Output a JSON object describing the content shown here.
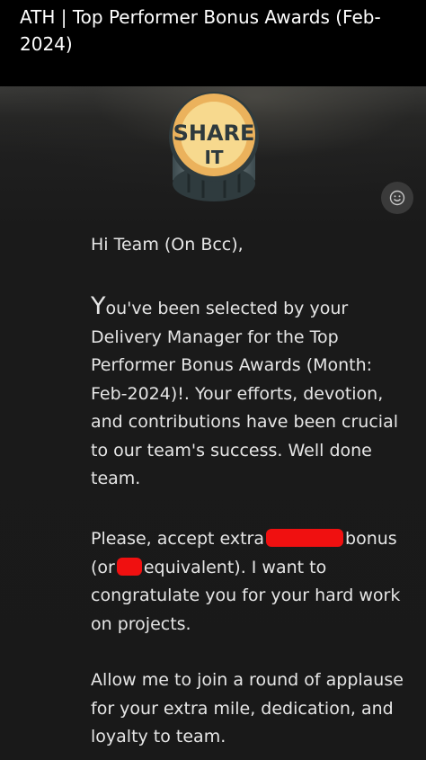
{
  "email": {
    "subject": "ATH | Top Performer Bonus Awards (Feb-2024)",
    "logo_text_top": "SHARE",
    "logo_text_bottom": "IT",
    "react_icon": "smiley-icon",
    "greeting": "Hi Team (On Bcc),",
    "para1": {
      "initial": "Y",
      "rest": "ou've been selected by your Delivery Manager for the Top Performer Bonus Awards (Month: ",
      "month": "Feb",
      "after_month": "-2024)!. Your efforts, devotion, and contributions have been crucial to our team's success. Well done team."
    },
    "para2": {
      "part1": "Please, accept extra",
      "part2": "bonus (or",
      "part3": "equivalent). I want to congratulate you for your hard work on projects."
    },
    "para3": "Allow me to join a round of applause for your extra mile, dedication, and loyalty to team."
  }
}
